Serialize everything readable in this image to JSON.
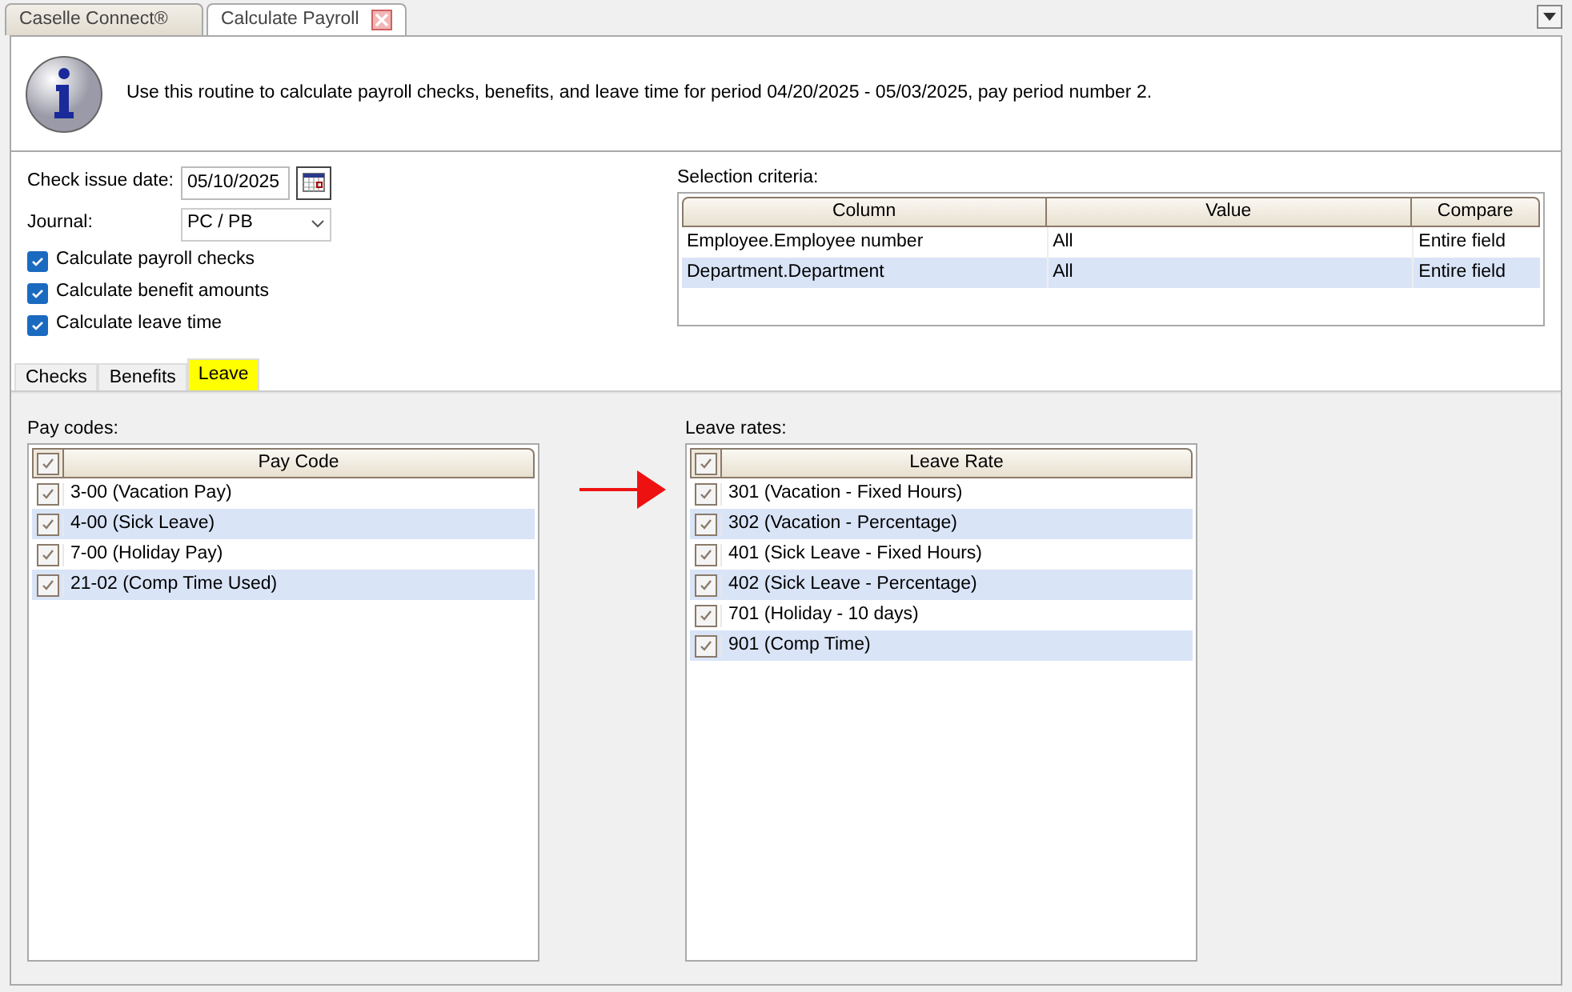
{
  "doc_tabs": [
    {
      "label": "Caselle Connect®",
      "selected": false,
      "closable": false
    },
    {
      "label": "Calculate Payroll",
      "selected": true,
      "closable": true
    }
  ],
  "info": "Use this routine to calculate payroll checks, benefits, and leave time for period 04/20/2025 - 05/03/2025, pay period number 2.",
  "check_issue_date": {
    "label": "Check issue date:",
    "value": "05/10/2025"
  },
  "journal": {
    "label": "Journal:",
    "value": "PC / PB"
  },
  "options": [
    {
      "label": "Calculate payroll checks",
      "checked": true
    },
    {
      "label": "Calculate benefit amounts",
      "checked": true
    },
    {
      "label": "Calculate leave time",
      "checked": true
    }
  ],
  "selection_criteria": {
    "label": "Selection criteria:",
    "columns": [
      "Column",
      "Value",
      "Compare"
    ],
    "rows": [
      [
        "Employee.Employee number",
        "All",
        "Entire field"
      ],
      [
        "Department.Department",
        "All",
        "Entire field"
      ]
    ]
  },
  "tabs": [
    {
      "label": "Checks",
      "selected": false
    },
    {
      "label": "Benefits",
      "selected": false
    },
    {
      "label": "Leave",
      "selected": true
    }
  ],
  "pay_codes": {
    "label": "Pay codes:",
    "header": "Pay Code",
    "all_checked": true,
    "items": [
      {
        "label": "3-00 (Vacation Pay)",
        "checked": true
      },
      {
        "label": "4-00 (Sick Leave)",
        "checked": true
      },
      {
        "label": "7-00 (Holiday Pay)",
        "checked": true
      },
      {
        "label": "21-02 (Comp Time Used)",
        "checked": true
      }
    ]
  },
  "leave_rates": {
    "label": "Leave rates:",
    "header": "Leave Rate",
    "all_checked": true,
    "items": [
      {
        "label": "301 (Vacation - Fixed Hours)",
        "checked": true
      },
      {
        "label": "302 (Vacation - Percentage)",
        "checked": true
      },
      {
        "label": "401 (Sick Leave - Fixed Hours)",
        "checked": true
      },
      {
        "label": "402 (Sick Leave - Percentage)",
        "checked": true
      },
      {
        "label": "701 (Holiday - 10 days)",
        "checked": true
      },
      {
        "label": "901 (Comp Time)",
        "checked": true
      }
    ]
  }
}
